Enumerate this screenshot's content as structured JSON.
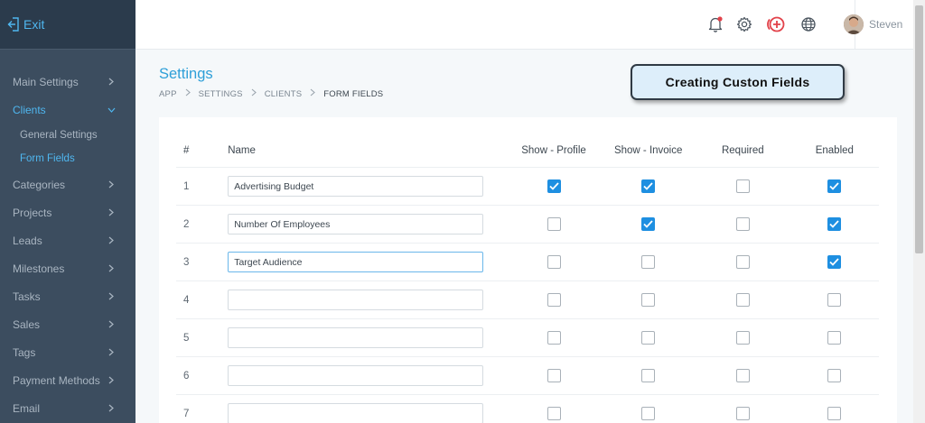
{
  "sidebar": {
    "exit_label": "Exit",
    "items": [
      {
        "label": "Main Settings"
      },
      {
        "label": "Clients"
      },
      {
        "label": "Categories"
      },
      {
        "label": "Projects"
      },
      {
        "label": "Leads"
      },
      {
        "label": "Milestones"
      },
      {
        "label": "Tasks"
      },
      {
        "label": "Sales"
      },
      {
        "label": "Tags"
      },
      {
        "label": "Payment Methods"
      },
      {
        "label": "Email"
      }
    ],
    "clients_sub": [
      {
        "label": "General Settings"
      },
      {
        "label": "Form Fields"
      }
    ]
  },
  "header": {
    "user_name": "Steven",
    "icons": [
      "bell-icon",
      "gear-icon",
      "add-circle-icon",
      "globe-icon"
    ]
  },
  "page": {
    "title": "Settings",
    "breadcrumb": [
      "APP",
      "SETTINGS",
      "CLIENTS",
      "FORM FIELDS"
    ]
  },
  "callout": {
    "text": "Creating Custon Fields"
  },
  "table": {
    "headers": {
      "num": "#",
      "name": "Name",
      "show_profile": "Show - Profile",
      "show_invoice": "Show - Invoice",
      "required": "Required",
      "enabled": "Enabled"
    },
    "rows": [
      {
        "num": "1",
        "name": "Advertising Budget",
        "show_profile": true,
        "show_invoice": true,
        "required": false,
        "enabled": true
      },
      {
        "num": "2",
        "name": "Number Of Employees",
        "show_profile": false,
        "show_invoice": true,
        "required": false,
        "enabled": true
      },
      {
        "num": "3",
        "name": "Target Audience",
        "show_profile": false,
        "show_invoice": false,
        "required": false,
        "enabled": true
      },
      {
        "num": "4",
        "name": "",
        "show_profile": false,
        "show_invoice": false,
        "required": false,
        "enabled": false
      },
      {
        "num": "5",
        "name": "",
        "show_profile": false,
        "show_invoice": false,
        "required": false,
        "enabled": false
      },
      {
        "num": "6",
        "name": "",
        "show_profile": false,
        "show_invoice": false,
        "required": false,
        "enabled": false
      },
      {
        "num": "7",
        "name": "",
        "show_profile": false,
        "show_invoice": false,
        "required": false,
        "enabled": false
      }
    ]
  },
  "colors": {
    "accent": "#4fb7f0",
    "sidebar_bg": "#3c4d5f",
    "checkbox_on": "#1e8fe1",
    "notification_dot": "#e2424a",
    "add_icon": "#e2424a"
  }
}
